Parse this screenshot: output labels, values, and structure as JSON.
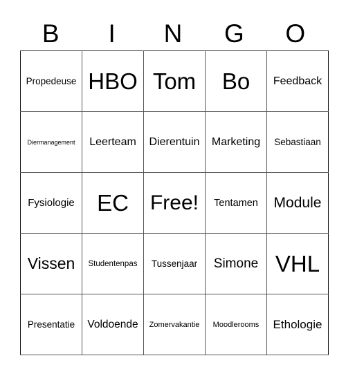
{
  "header": [
    "B",
    "I",
    "N",
    "G",
    "O"
  ],
  "rows": [
    [
      "Propedeuse",
      "HBO",
      "Tom",
      "Bo",
      "Feedback"
    ],
    [
      "Diermanagement",
      "Leerteam",
      "Dierentuin",
      "Marketing",
      "Sebastiaan"
    ],
    [
      "Fysiologie",
      "EC",
      "Free!",
      "Tentamen",
      "Module"
    ],
    [
      "Vissen",
      "Studentenpas",
      "Tussenjaar",
      "Simone",
      "VHL"
    ],
    [
      "Presentatie",
      "Voldoende",
      "Zomervakantie",
      "Moodlerooms",
      "Ethologie"
    ]
  ]
}
